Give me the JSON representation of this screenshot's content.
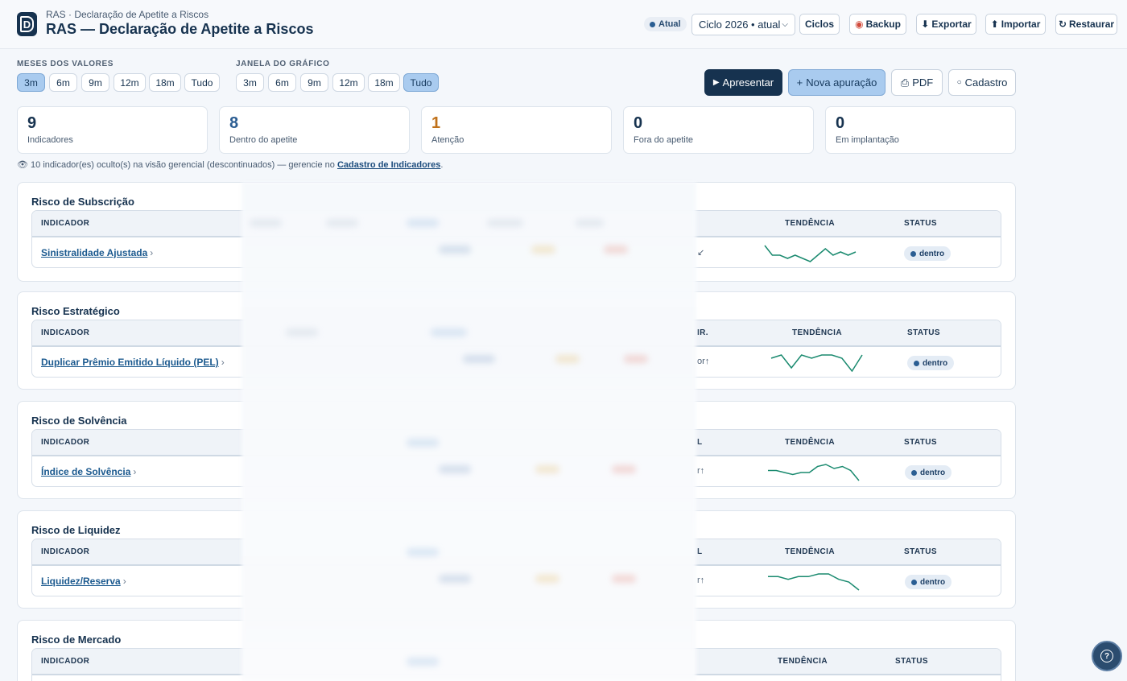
{
  "header": {
    "breadcrumb": "RAS · Declaração de Apetite a Riscos",
    "title": "RAS — Declaração de Apetite a Riscos",
    "logo_letter": "D",
    "status_pill": "Atual",
    "cycle_select": "Ciclo 2026 • atual",
    "buttons": {
      "ciclos": "Ciclos",
      "backup": "Backup",
      "exportar": "Exportar",
      "importar": "Importar",
      "restaurar": "Restaurar"
    }
  },
  "filters": {
    "months_label": "MESES DOS VALORES",
    "months_options": [
      "3m",
      "6m",
      "9m",
      "12m",
      "18m",
      "Tudo"
    ],
    "months_selected": "3m",
    "window_label": "JANELA DO GRÁFICO",
    "window_options": [
      "3m",
      "6m",
      "9m",
      "12m",
      "18m",
      "Tudo"
    ],
    "window_selected": "Tudo"
  },
  "actions": {
    "apresentar": "Apresentar",
    "nova_apuracao": "Nova apuração",
    "pdf": "PDF",
    "cadastro": "Cadastro"
  },
  "kpis": [
    {
      "value": "9",
      "label": "Indicadores",
      "color": "#16324f"
    },
    {
      "value": "8",
      "label": "Dentro do apetite",
      "color": "#2b5d92"
    },
    {
      "value": "1",
      "label": "Atenção",
      "color": "#c0711a"
    },
    {
      "value": "0",
      "label": "Fora do apetite",
      "color": "#16324f"
    },
    {
      "value": "0",
      "label": "Em implantação",
      "color": "#16324f"
    }
  ],
  "note": {
    "text": "10 indicador(es) oculto(s) na visão gerencial (descontinuados) — gerencie no",
    "link": "Cadastro de Indicadores",
    "end": "."
  },
  "table_headers": {
    "indicador": "INDICADOR",
    "tendencia": "TENDÊNCIA",
    "status": "STATUS"
  },
  "sections": [
    {
      "title": "Risco de Subscrição",
      "indicator": "Sinistralidade Ajustada",
      "dir_header": "",
      "dir": "↙",
      "status": "dentro",
      "trend": [
        9,
        6,
        6,
        5,
        6,
        5,
        4,
        6,
        8,
        6,
        7,
        6,
        7
      ]
    },
    {
      "title": "Risco Estratégico",
      "indicator": "Duplicar Prêmio Emitido Líquido (PEL)",
      "dir_header": "IR.",
      "dir": "or↑",
      "status": "dentro",
      "trend": [
        7,
        8,
        4,
        8,
        7,
        8,
        8,
        7,
        3,
        8
      ]
    },
    {
      "title": "Risco de Solvência",
      "indicator": "Índice de Solvência",
      "dir_header": "L",
      "dir": "r↑",
      "status": "dentro",
      "trend": [
        7,
        7,
        6,
        5,
        6,
        6,
        9,
        10,
        8,
        9,
        7,
        2
      ]
    },
    {
      "title": "Risco de Liquidez",
      "indicator": "Liquidez/Reserva",
      "dir_header": "L",
      "dir": "r↑",
      "status": "dentro",
      "trend": [
        8,
        8,
        7,
        8,
        8,
        9,
        9,
        7,
        6,
        3
      ]
    },
    {
      "title": "Risco de Mercado",
      "indicator": "",
      "dir_header": "",
      "dir": "",
      "status": "",
      "trend": []
    }
  ],
  "icons": {
    "help": "question-circle-icon"
  },
  "colors": {
    "primary": "#16324f",
    "accent": "#a9cbef",
    "trend_line": "#1a8a6f",
    "attention": "#c0711a"
  }
}
